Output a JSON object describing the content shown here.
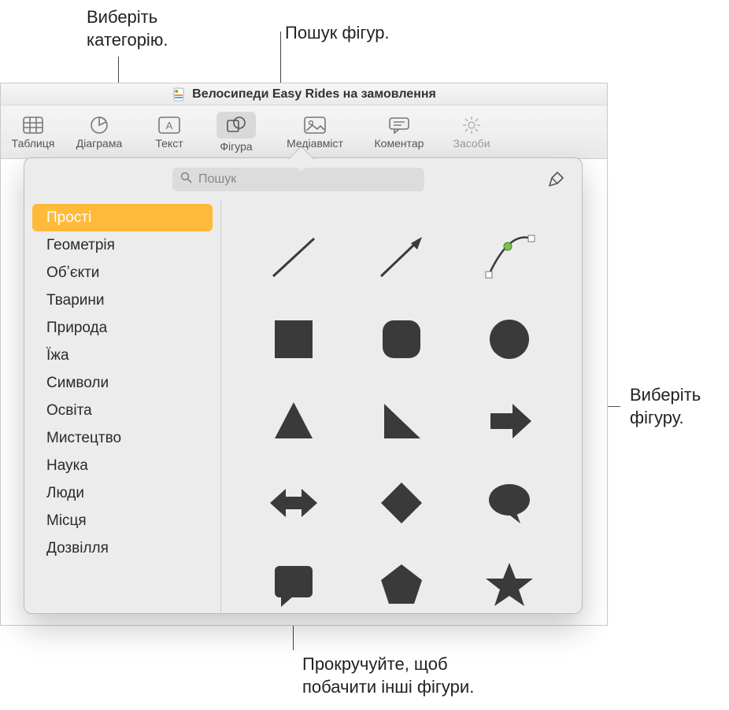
{
  "callouts": {
    "category": "Виберіть\nкатегорію.",
    "search": "Пошук фігур.",
    "choose_shape": "Виберіть\nфігуру.",
    "scroll": "Прокручуйте, щоб\nпобачити інші фігури."
  },
  "window": {
    "title": "Велосипеди Easy Rides на замовлення"
  },
  "toolbar": {
    "table": "Таблиця",
    "chart": "Діаграма",
    "text": "Текст",
    "shape": "Фігура",
    "media": "Медіавміст",
    "comment": "Коментар",
    "tools": "Засоби"
  },
  "popover": {
    "search_placeholder": "Пошук"
  },
  "sidebar": {
    "items": [
      "Прості",
      "Геометрія",
      "Обʼєкти",
      "Тварини",
      "Природа",
      "Їжа",
      "Символи",
      "Освіта",
      "Мистецтво",
      "Наука",
      "Люди",
      "Місця",
      "Дозвілля"
    ],
    "selected_index": 0
  },
  "shapes": [
    "line",
    "arrow-line",
    "curve",
    "square",
    "rounded-square",
    "circle",
    "triangle",
    "right-triangle",
    "arrow-right",
    "double-arrow",
    "diamond",
    "speech-bubble",
    "callout-rect",
    "pentagon",
    "star"
  ]
}
